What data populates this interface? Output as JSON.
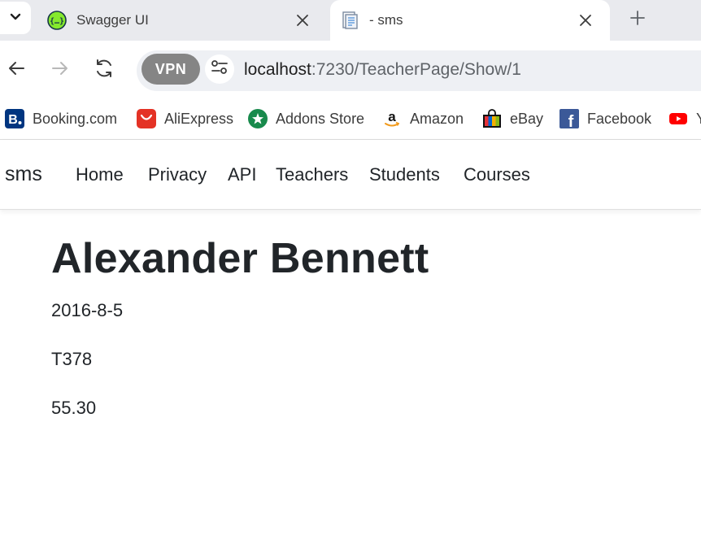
{
  "browser": {
    "tabs": [
      {
        "title": "Swagger UI",
        "active": false
      },
      {
        "title": "- sms",
        "active": true
      }
    ],
    "address": {
      "host": "localhost",
      "path": ":7230/TeacherPage/Show/1",
      "vpn_label": "VPN"
    },
    "bookmarks": [
      {
        "label": "Booking.com",
        "icon": "booking-icon"
      },
      {
        "label": "AliExpress",
        "icon": "aliexpress-icon"
      },
      {
        "label": "Addons Store",
        "icon": "addons-store-icon"
      },
      {
        "label": "Amazon",
        "icon": "amazon-icon"
      },
      {
        "label": "eBay",
        "icon": "ebay-icon"
      },
      {
        "label": "Facebook",
        "icon": "facebook-icon"
      },
      {
        "label": "Y",
        "icon": "youtube-icon"
      }
    ]
  },
  "site": {
    "brand": "sms",
    "nav": [
      "Home",
      "Privacy",
      "API",
      "Teachers",
      "Students",
      "Courses"
    ]
  },
  "teacher": {
    "name": "Alexander Bennett",
    "hire_date": "2016-8-5",
    "employee_number": "T378",
    "salary": "55.30"
  },
  "colors": {
    "tabstrip_bg": "#e9eaee",
    "omnibox_bg": "#eef0f4",
    "vpn_badge": "#858585",
    "text": "#212529"
  }
}
